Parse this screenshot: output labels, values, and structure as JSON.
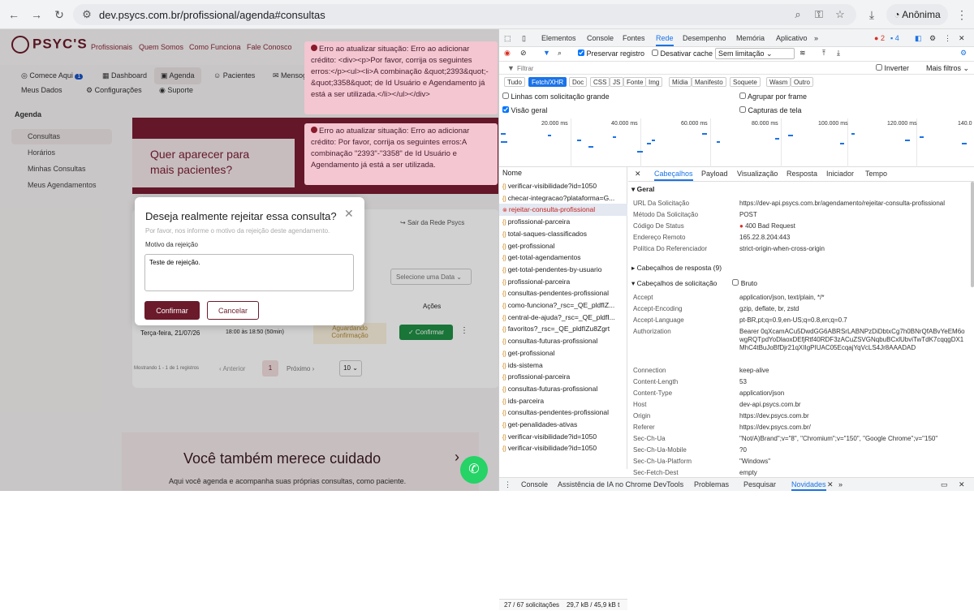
{
  "browser": {
    "url": "dev.psycs.com.br/profissional/agenda#consultas",
    "profile_label": "Anônima",
    "icons": [
      "back-icon",
      "forward-icon",
      "reload-icon",
      "site-info-icon",
      "zoom-icon",
      "key-icon",
      "star-icon",
      "download-icon",
      "incognito-icon",
      "menu-icon"
    ]
  },
  "site": {
    "brand": "PSYC'S",
    "main_nav": [
      "Profissionais",
      "Quem Somos",
      "Como Funciona",
      "Fale Conosco"
    ],
    "subnav": [
      "Comece Aqui",
      "Dashboard",
      "Agenda",
      "Pacientes",
      "Mensog"
    ],
    "subnav2": [
      "Meus Dados",
      "Configurações",
      "Suporte"
    ],
    "comece_badge": "1",
    "sidebar_heading": "Agenda",
    "sidebar": [
      "Consultas",
      "Horários",
      "Minhas Consultas",
      "Meus Agendamentos"
    ],
    "banner_text": "Quer aparecer para mais pacientes?",
    "leave_link": "Sair da Rede Psycs",
    "date_select": "Selecione uma Data",
    "actions_col": "Ações",
    "row": {
      "date": "Terça-feira, 21/07/26",
      "time": "18:00 às 18:50 (50min)",
      "status": "Aguardando Confirmação",
      "confirm": "✓ Confirmar"
    },
    "pagination": {
      "summary": "Mostrando 1 - 1 de 1 registros",
      "prev": "Anterior",
      "page": "1",
      "next": "Próximo",
      "per_page": "10"
    },
    "footer_title": "Você também merece cuidado",
    "footer_text": "Aqui você agenda e acompanha suas próprias consultas, como paciente."
  },
  "modal": {
    "title": "Deseja realmente rejeitar essa consulta?",
    "subtitle": "Por favor, nos informe o motivo da rejeição deste agendamento.",
    "label": "Motivo da rejeição",
    "value": "Teste de rejeição.",
    "confirm": "Confirmar",
    "cancel": "Cancelar"
  },
  "toasts": [
    "Erro ao atualizar situação: Erro ao adicionar crédito: <div><p>Por favor, corrija os seguintes erros:</p><ul><li>A combinação &quot;2393&quot;-&quot;3358&quot; de Id Usuário e Agendamento já está a ser utilizada.</li></ul></div>",
    "Erro ao atualizar situação: Erro ao adicionar crédito: Por favor, corrija os seguintes erros:A combinação \"2393\"-\"3358\" de Id Usuário e Agendamento já está a ser utilizada."
  ],
  "devtools": {
    "tabs": [
      "Elementos",
      "Console",
      "Fontes",
      "Rede",
      "Desempenho",
      "Memória",
      "Aplicativo"
    ],
    "badges": {
      "errors": "2",
      "warnings": "4"
    },
    "preserve_log": "Preservar registro",
    "disable_cache": "Desativar cache",
    "throttle": "Sem limitação",
    "filter_placeholder": "Filtrar",
    "invert": "Inverter",
    "more_filters": "Mais filtros",
    "type_chips": [
      "Tudo",
      "Fetch/XHR",
      "Doc",
      "CSS",
      "JS",
      "Fonte",
      "Img",
      "Mídia",
      "Manifesto",
      "Soquete",
      "Wasm",
      "Outro"
    ],
    "options": [
      "Linhas com solicitação grande",
      "Agrupar por frame",
      "Visão geral",
      "Capturas de tela"
    ],
    "timeline": [
      "20.000 ms",
      "40.000 ms",
      "60.000 ms",
      "80.000 ms",
      "100.000 ms",
      "120.000 ms",
      "140.0"
    ],
    "name_header": "Nome",
    "requests": [
      "verificar-visibilidade?id=1050",
      "checar-integracao?plataforma=G...",
      "rejeitar-consulta-profissional",
      "profissional-parceira",
      "total-saques-classificados",
      "get-profissional",
      "get-total-agendamentos",
      "get-total-pendentes-by-usuario",
      "profissional-parceira",
      "consultas-pendentes-profissional",
      "como-funciona?_rsc=_QE_pldfIZ...",
      "central-de-ajuda?_rsc=_QE_pldfI...",
      "favoritos?_rsc=_QE_pldfIZu8Zgrt",
      "consultas-futuras-profissional",
      "get-profissional",
      "ids-sistema",
      "profissional-parceira",
      "consultas-futuras-profissional",
      "ids-parceira",
      "consultas-pendentes-profissional",
      "get-penalidades-ativas",
      "verificar-visibilidade?id=1050",
      "verificar-visibilidade?id=1050"
    ],
    "detail_tabs": [
      "Cabeçalhos",
      "Payload",
      "Visualização",
      "Resposta",
      "Iniciador",
      "Tempo"
    ],
    "general_heading": "Geral",
    "general": [
      [
        "URL Da Solicitação",
        "https://dev-api.psycs.com.br/agendamento/rejeitar-consulta-profissional"
      ],
      [
        "Método Da Solicitação",
        "POST"
      ],
      [
        "Código De Status",
        "400 Bad Request"
      ],
      [
        "Endereço Remoto",
        "165.22.8.204:443"
      ],
      [
        "Política Do Referenciador",
        "strict-origin-when-cross-origin"
      ]
    ],
    "resp_heading": "Cabeçalhos de resposta (9)",
    "req_heading": "Cabeçalhos de solicitação",
    "raw": "Bruto",
    "req_headers": [
      [
        "Accept",
        "application/json, text/plain, */*"
      ],
      [
        "Accept-Encoding",
        "gzip, deflate, br, zstd"
      ],
      [
        "Accept-Language",
        "pt-BR,pt;q=0.9,en-US;q=0.8,en;q=0.7"
      ],
      [
        "Authorization",
        "Bearer 0qXcamACu5DwdGG6ABRSrLABNPzDiDbtxCg7h0BNrQfABvYeEM6owgRQTpdYoDlaoxDEfjRtf40RDF3zACuZSVGNqbuBCxlUbviTwTdK7cqqgDX1MhC4tBuJoBfDjr21qXIIgPIUAC05EcqajYqVcLS4Jr8AAADAD"
      ],
      [
        "Connection",
        "keep-alive"
      ],
      [
        "Content-Length",
        "53"
      ],
      [
        "Content-Type",
        "application/json"
      ],
      [
        "Host",
        "dev-api.psycs.com.br"
      ],
      [
        "Origin",
        "https://dev.psycs.com.br"
      ],
      [
        "Referer",
        "https://dev.psycs.com.br/"
      ],
      [
        "Sec-Ch-Ua",
        "\"Not/A)Brand\";v=\"8\", \"Chromium\";v=\"150\", \"Google Chrome\";v=\"150\""
      ],
      [
        "Sec-Ch-Ua-Mobile",
        "?0"
      ],
      [
        "Sec-Ch-Ua-Platform",
        "\"Windows\""
      ],
      [
        "Sec-Fetch-Dest",
        "empty"
      ]
    ],
    "status_bar": [
      "27 / 67 solicitações",
      "29,7 kB / 45,9 kB t"
    ],
    "drawer": [
      "Console",
      "Assistência de IA no Chrome DevTools",
      "Problemas",
      "Pesquisar",
      "Novidades"
    ]
  }
}
